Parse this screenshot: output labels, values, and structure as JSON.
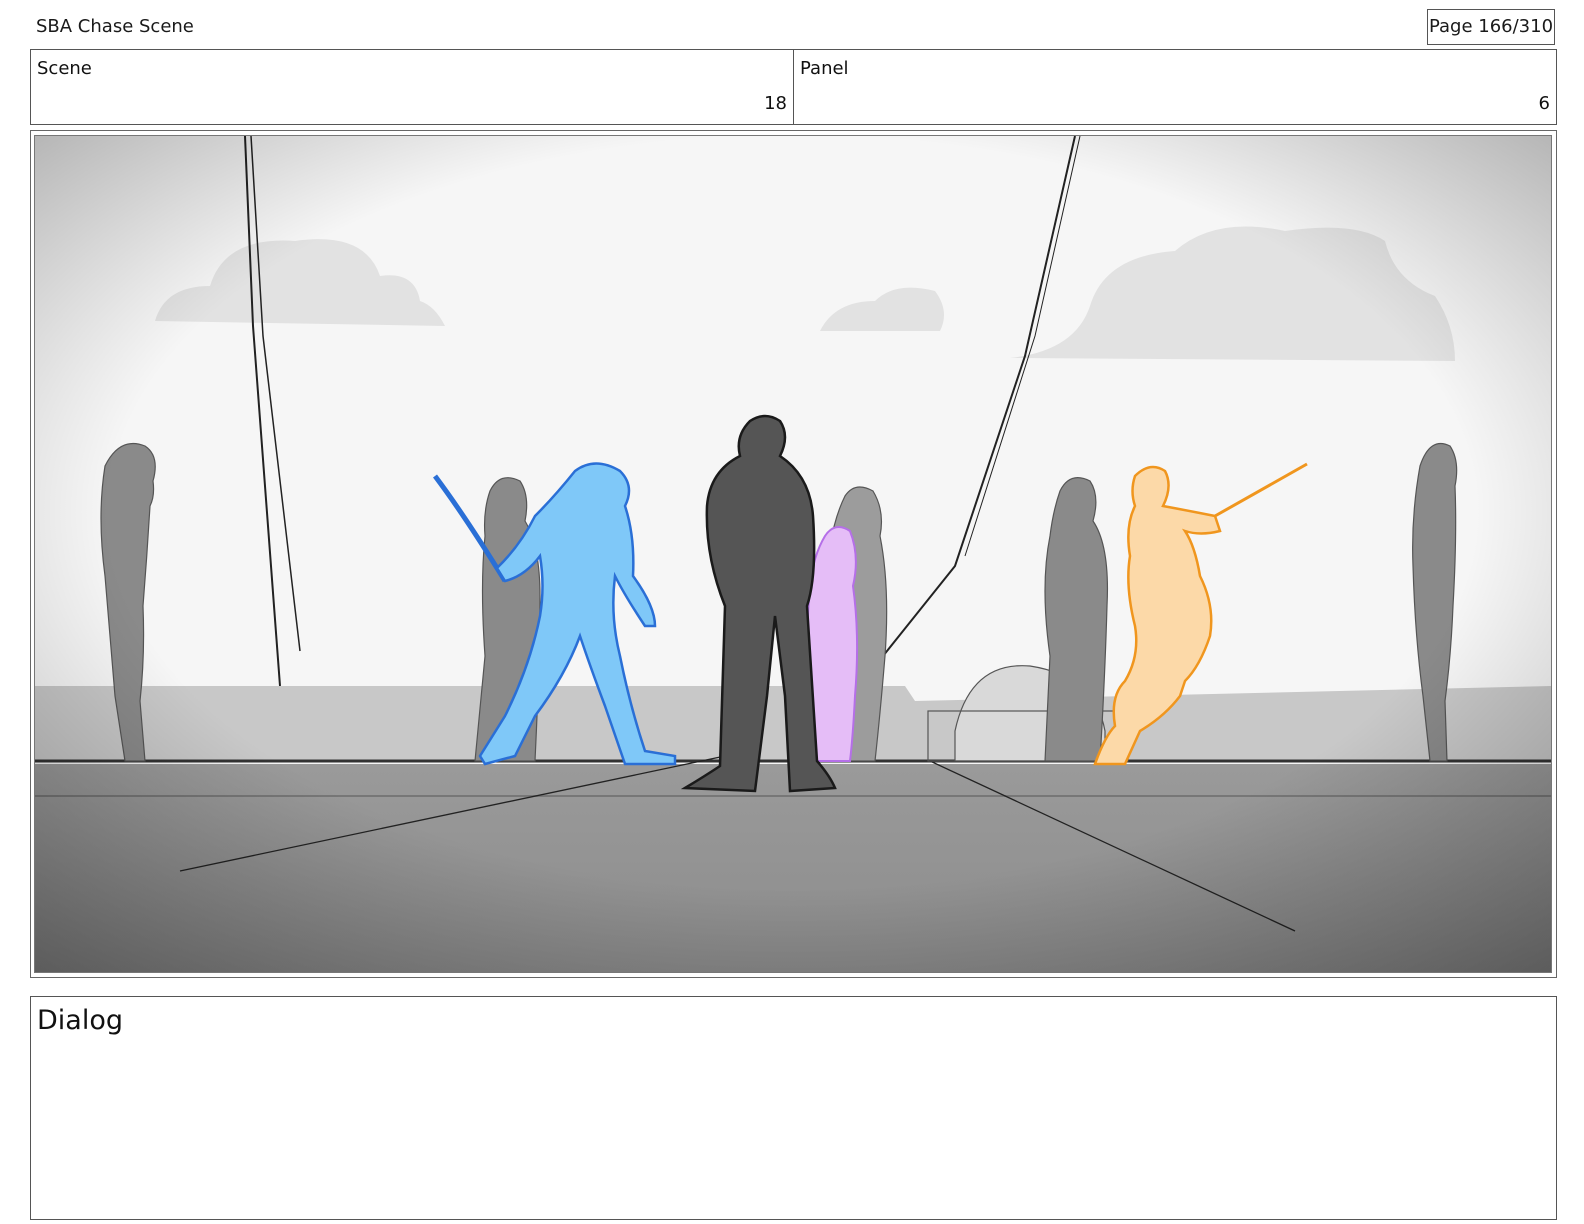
{
  "header": {
    "title": "SBA Chase Scene",
    "page_label": "Page 166/310"
  },
  "info": {
    "scene_label": "Scene",
    "scene_value": "18",
    "panel_label": "Panel",
    "panel_value": "6"
  },
  "panel_image": {
    "description_name": "storyboard-panel-drawing",
    "colors": {
      "blue_character": "#7fc8f8",
      "blue_outline": "#2a6fd6",
      "orange_character": "#fcd9a8",
      "orange_outline": "#f0961e",
      "purple_character": "#e5bdf7",
      "purple_outline": "#b56fe8",
      "dark_character": "#555555",
      "background_figures": "#8a8a8a",
      "cloud": "#e3e3e3"
    }
  },
  "dialog": {
    "label": "Dialog",
    "text": ""
  }
}
